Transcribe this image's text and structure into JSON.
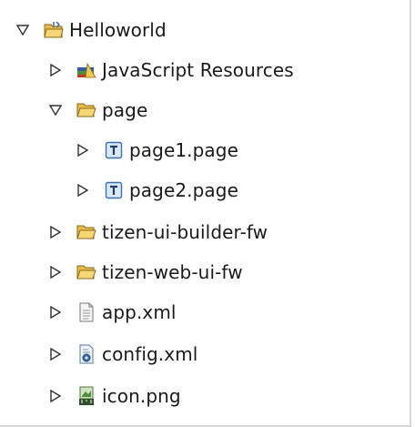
{
  "tree": {
    "items": [
      {
        "label": "Helloworld",
        "icon": "project-icon",
        "expanded": true
      },
      {
        "label": "JavaScript Resources",
        "icon": "javascript-resources-icon",
        "expanded": false
      },
      {
        "label": "page",
        "icon": "folder-open-icon",
        "expanded": true
      },
      {
        "label": "page1.page",
        "icon": "page-file-icon",
        "expanded": false
      },
      {
        "label": "page2.page",
        "icon": "page-file-icon",
        "expanded": false
      },
      {
        "label": "tizen-ui-builder-fw",
        "icon": "folder-icon",
        "expanded": false
      },
      {
        "label": "tizen-web-ui-fw",
        "icon": "folder-icon",
        "expanded": false
      },
      {
        "label": "app.xml",
        "icon": "xml-file-icon",
        "expanded": false
      },
      {
        "label": "config.xml",
        "icon": "config-file-icon",
        "expanded": false
      },
      {
        "label": "icon.png",
        "icon": "png-file-icon",
        "expanded": false
      }
    ]
  }
}
